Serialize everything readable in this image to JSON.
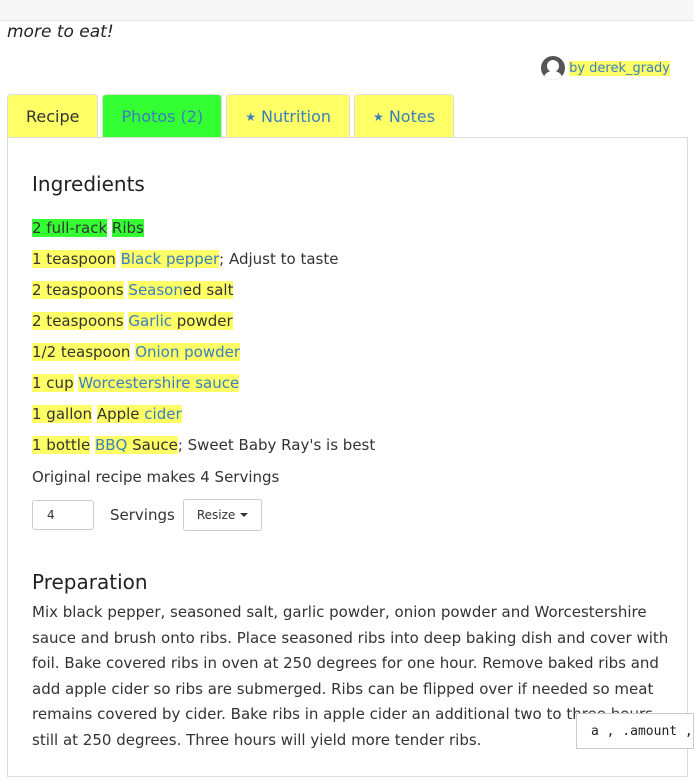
{
  "intro_text": "more to eat!",
  "author": {
    "label": "by derek_grady"
  },
  "tabs": [
    {
      "label": "Recipe"
    },
    {
      "label": "Photos (2)"
    },
    {
      "label": "Nutrition"
    },
    {
      "label": "Notes"
    }
  ],
  "ingredients": {
    "title": "Ingredients",
    "items": [
      {
        "amount": "2 full-rack",
        "name": "Ribs",
        "note": ""
      },
      {
        "amount": "1 teaspoon",
        "name": "Black pepper",
        "note": "; Adjust to taste"
      },
      {
        "amount": "2 teaspoons",
        "name_link": "Season",
        "name_plain": "ed salt"
      },
      {
        "amount": "2 teaspoons",
        "name_link": "Garlic",
        "name_plain": " powder"
      },
      {
        "amount": "1/2 teaspoon",
        "name_link": "Onion powder",
        "name_plain": ""
      },
      {
        "amount": "1 cup",
        "name_link": "Worcestershire sauce",
        "name_plain": ""
      },
      {
        "amount": "1 gallon",
        "name_plain": "Apple ",
        "name_link": "cider"
      },
      {
        "amount": "1 bottle",
        "name_link": "BBQ",
        "name_plain": " Sauce",
        "note": "; Sweet Baby Ray's is best"
      }
    ],
    "makes": "Original recipe makes 4 Servings",
    "servings_value": "4",
    "servings_label": "Servings",
    "resize_label": "Resize"
  },
  "preparation": {
    "title": "Preparation",
    "text": "Mix black pepper, seasoned salt, garlic powder, onion powder and Worcestershire sauce and brush onto ribs. Place seasoned ribs into deep baking dish and cover with foil. Bake covered ribs in oven at 250 degrees for one hour. Remove baked ribs and add apple cider so ribs are submerged. Ribs can be flipped over if needed so meat remains covered by cider. Bake ribs in apple cider an additional two to three hours, still at 250 degrees. Three hours will yield more tender ribs."
  },
  "tooltip": {
    "text": "a , .amount , "
  },
  "colors": {
    "highlight_yellow": "#ffff66",
    "highlight_green": "#33ff33",
    "link": "#3a7fbf"
  }
}
